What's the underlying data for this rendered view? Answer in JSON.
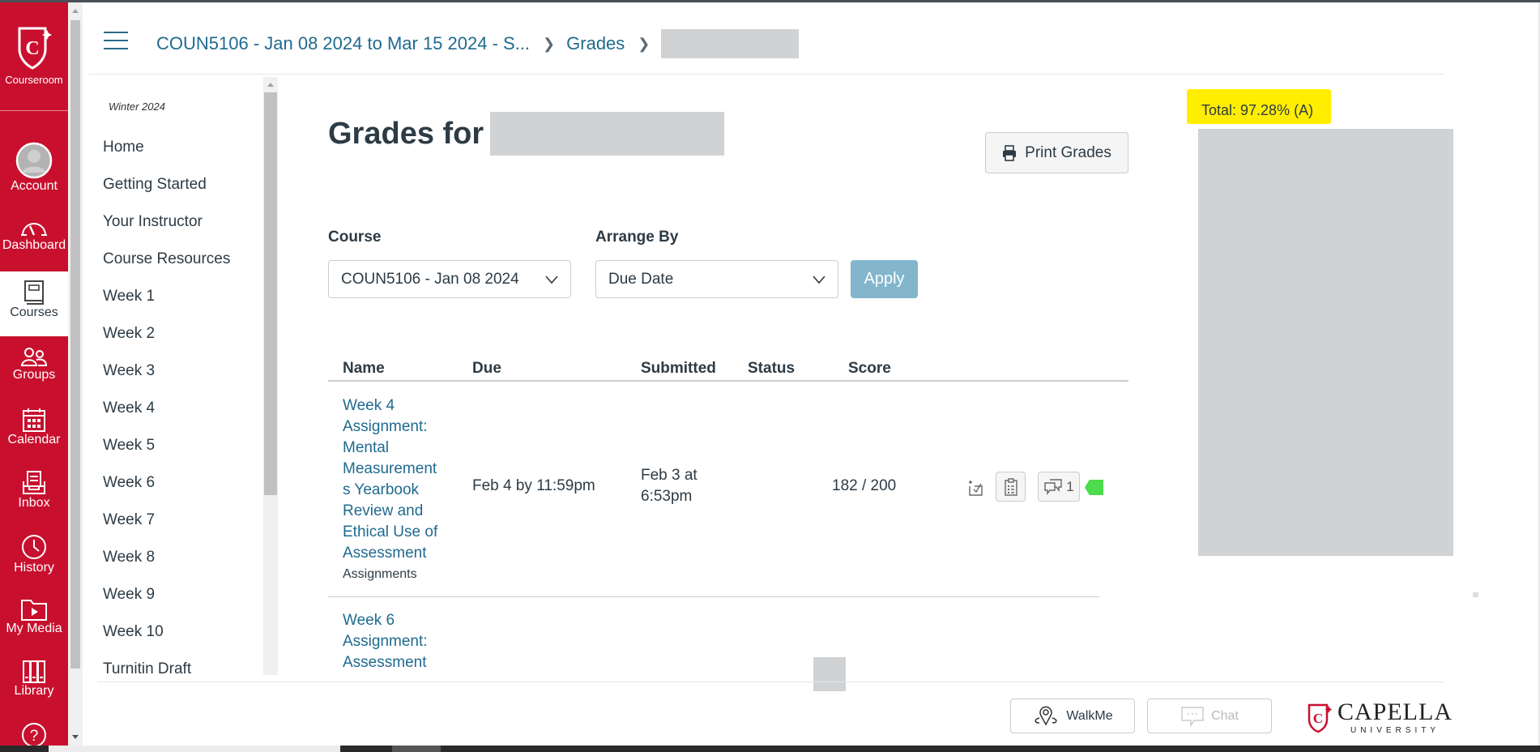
{
  "global_nav": {
    "logo_label": "Courseroom",
    "items": [
      {
        "label": "Account",
        "icon": "account-avatar-icon"
      },
      {
        "label": "Dashboard",
        "icon": "dashboard-gauge-icon"
      },
      {
        "label": "Courses",
        "icon": "courses-book-icon",
        "active": true
      },
      {
        "label": "Groups",
        "icon": "groups-people-icon"
      },
      {
        "label": "Calendar",
        "icon": "calendar-icon"
      },
      {
        "label": "Inbox",
        "icon": "inbox-tray-icon"
      },
      {
        "label": "History",
        "icon": "history-clock-icon"
      },
      {
        "label": "My Media",
        "icon": "media-folder-play-icon"
      },
      {
        "label": "Library",
        "icon": "library-books-icon"
      },
      {
        "label": "",
        "icon": "help-question-icon"
      }
    ]
  },
  "header": {
    "breadcrumb": [
      {
        "label": "COUN5106 - Jan 08 2024 to Mar 15 2024 - S..."
      },
      {
        "label": "Grades"
      },
      {
        "label": "[redacted]"
      }
    ]
  },
  "course_nav": {
    "term": "Winter 2024",
    "items": [
      "Home",
      "Getting Started",
      "Your Instructor",
      "Course Resources",
      "Week 1",
      "Week 2",
      "Week 3",
      "Week 4",
      "Week 5",
      "Week 6",
      "Week 7",
      "Week 8",
      "Week 9",
      "Week 10",
      "Turnitin Draft"
    ]
  },
  "main": {
    "title": "Grades for",
    "print_label": "Print Grades",
    "course_label": "Course",
    "course_value": "COUN5106 - Jan 08 2024",
    "arrange_label": "Arrange By",
    "arrange_value": "Due Date",
    "apply_label": "Apply"
  },
  "table": {
    "headers": [
      "Name",
      "Due",
      "Submitted",
      "Status",
      "Score"
    ],
    "rows": [
      {
        "name": "Week 4 Assignment: Mental Measurements Yearbook Review and Ethical Use of Assessment",
        "name_lines": [
          "Week 4",
          "Assignment:",
          "Mental",
          "Measurement",
          "s Yearbook",
          "Review and",
          "Ethical Use of",
          "Assessment"
        ],
        "group": "Assignments",
        "due": "Feb 4 by 11:59pm",
        "submitted_lines": [
          "Feb 3 at",
          "6:53pm"
        ],
        "status": "",
        "score": "182 / 200",
        "comments_count": "1"
      },
      {
        "name_lines": [
          "Week 6",
          "Assignment:",
          "Assessment"
        ],
        "group": "",
        "due": "",
        "submitted_lines": [],
        "status": "",
        "score": ""
      }
    ]
  },
  "right_panel": {
    "total": "Total: 97.28% (A)",
    "highlight_color": "#ffee00"
  },
  "footer": {
    "walkme_label": "WalkMe",
    "chat_label": "Chat",
    "brand_name": "CAPELLA",
    "brand_sub": "UNIVERSITY"
  },
  "colors": {
    "brand_red": "#c8102e",
    "link_blue": "#1f6a8f",
    "apply_blue": "#83b6cc",
    "redaction_gray": "#d0d2d4",
    "flag_green": "#4cdc4c"
  }
}
